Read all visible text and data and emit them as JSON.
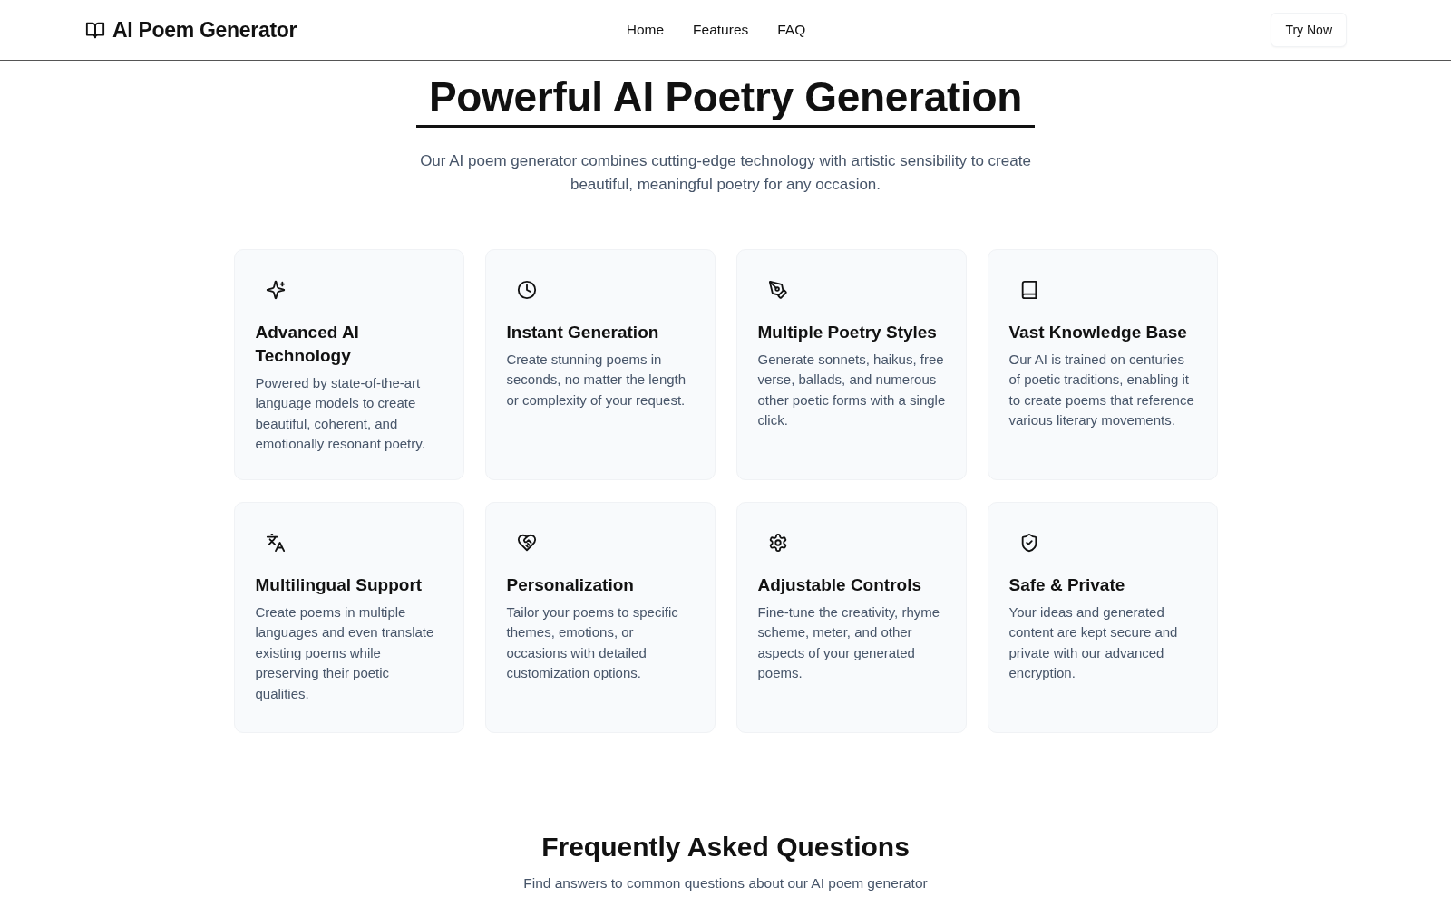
{
  "header": {
    "logo": "AI Poem Generator",
    "nav": [
      {
        "label": "Home"
      },
      {
        "label": "Features"
      },
      {
        "label": "FAQ"
      }
    ],
    "cta": "Try Now"
  },
  "features_section": {
    "title": "Powerful AI Poetry Generation",
    "subtitle": "Our AI poem generator combines cutting-edge technology with artistic sensibility to create beautiful, meaningful poetry for any occasion.",
    "cards": [
      {
        "kind": "sparkles",
        "title": "Advanced AI Technology",
        "text": "Powered by state-of-the-art language models to create beautiful, coherent, and emotionally resonant poetry."
      },
      {
        "kind": "clock",
        "title": "Instant Generation",
        "text": "Create stunning poems in seconds, no matter the length or complexity of your request."
      },
      {
        "kind": "pen",
        "title": "Multiple Poetry Styles",
        "text": "Generate sonnets, haikus, free verse, ballads, and numerous other poetic forms with a single click."
      },
      {
        "kind": "book",
        "title": "Vast Knowledge Base",
        "text": "Our AI is trained on centuries of poetic traditions, enabling it to create poems that reference various literary movements."
      },
      {
        "kind": "languages",
        "title": "Multilingual Support",
        "text": "Create poems in multiple languages and even translate existing poems while preserving their poetic qualities."
      },
      {
        "kind": "heart",
        "title": "Personalization",
        "text": "Tailor your poems to specific themes, emotions, or occasions with detailed customization options."
      },
      {
        "kind": "gear",
        "title": "Adjustable Controls",
        "text": "Fine-tune the creativity, rhyme scheme, meter, and other aspects of your generated poems."
      },
      {
        "kind": "shield",
        "title": "Safe & Private",
        "text": "Your ideas and generated content are kept secure and private with our advanced encryption."
      }
    ]
  },
  "faq_section": {
    "title": "Frequently Asked Questions",
    "subtitle": "Find answers to common questions about our AI poem generator"
  }
}
